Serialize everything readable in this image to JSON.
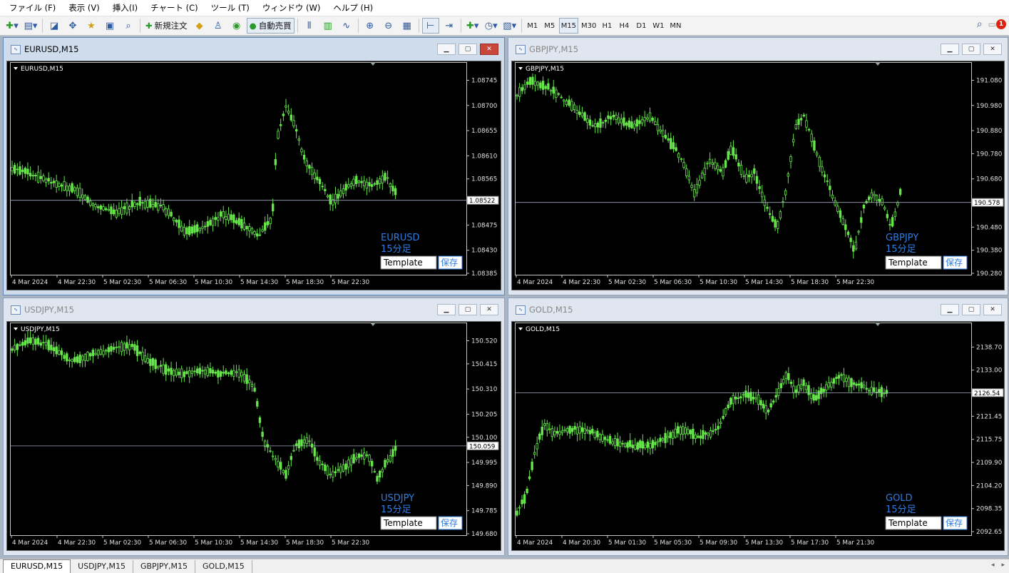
{
  "menu": [
    "ファイル (F)",
    "表示 (V)",
    "挿入(I)",
    "チャート (C)",
    "ツール (T)",
    "ウィンドウ (W)",
    "ヘルプ (H)"
  ],
  "toolbar": {
    "new_order": "新規注文",
    "auto_trade": "自動売買",
    "timeframes": [
      "M1",
      "M5",
      "M15",
      "M30",
      "H1",
      "H4",
      "D1",
      "W1",
      "MN"
    ],
    "active_timeframe": "M15",
    "notification_count": "1"
  },
  "panel": {
    "timeframe_label": "15分足",
    "template_value": "Template",
    "save_label": "保存"
  },
  "windows": [
    {
      "key": "eurusd",
      "title": "EURUSD,M15",
      "chart_label": "EURUSD,M15",
      "symbol": "EURUSD",
      "active": true,
      "price_ticks": [
        "1.08745",
        "1.08700",
        "1.08655",
        "1.08610",
        "1.08565",
        "1.08475",
        "1.08430",
        "1.08385"
      ],
      "current_price": "1.08522",
      "time_ticks": [
        "4 Mar 2024",
        "4 Mar 22:30",
        "5 Mar 02:30",
        "5 Mar 06:30",
        "5 Mar 10:30",
        "5 Mar 14:30",
        "5 Mar 18:30",
        "5 Mar 22:30"
      ]
    },
    {
      "key": "gbpjpy",
      "title": "GBPJPY,M15",
      "chart_label": "GBPJPY,M15",
      "symbol": "GBPJPY",
      "active": false,
      "price_ticks": [
        "191.080",
        "190.980",
        "190.880",
        "190.780",
        "190.680",
        "190.480",
        "190.380",
        "190.280"
      ],
      "current_price": "190.578",
      "time_ticks": [
        "4 Mar 2024",
        "4 Mar 22:30",
        "5 Mar 02:30",
        "5 Mar 06:30",
        "5 Mar 10:30",
        "5 Mar 14:30",
        "5 Mar 18:30",
        "5 Mar 22:30"
      ]
    },
    {
      "key": "usdjpy",
      "title": "USDJPY,M15",
      "chart_label": "USDJPY,M15",
      "symbol": "USDJPY",
      "active": false,
      "price_ticks": [
        "150.520",
        "150.415",
        "150.310",
        "150.205",
        "150.100",
        "149.995",
        "149.890",
        "149.785",
        "149.680"
      ],
      "current_price": "150.059",
      "time_ticks": [
        "4 Mar 2024",
        "4 Mar 22:30",
        "5 Mar 02:30",
        "5 Mar 06:30",
        "5 Mar 10:30",
        "5 Mar 14:30",
        "5 Mar 18:30",
        "5 Mar 22:30"
      ]
    },
    {
      "key": "gold",
      "title": "GOLD,M15",
      "chart_label": "GOLD,M15",
      "symbol": "GOLD",
      "active": false,
      "price_ticks": [
        "2138.70",
        "2133.00",
        "2121.45",
        "2115.75",
        "2109.90",
        "2104.20",
        "2098.35",
        "2092.65"
      ],
      "current_price": "2126.54",
      "time_ticks": [
        "4 Mar 2024",
        "4 Mar 20:30",
        "5 Mar 01:30",
        "5 Mar 05:30",
        "5 Mar 09:30",
        "5 Mar 13:30",
        "5 Mar 17:30",
        "5 Mar 21:30"
      ]
    }
  ],
  "tabs": [
    "EURUSD,M15",
    "USDJPY,M15",
    "GBPJPY,M15",
    "GOLD,M15"
  ],
  "colors": {
    "candle": "#66e64a",
    "price_line": "#a0a8b8",
    "label_text": "#2f7de0",
    "chart_bg": "#000000"
  },
  "icons": [
    "new-chart-icon",
    "profiles-icon",
    "market-watch-icon",
    "crosshair-icon",
    "navigator-icon",
    "terminal-icon",
    "strategy-tester-icon",
    "new-order-icon",
    "metaeditor-icon",
    "auto-trading-icon",
    "bar-chart-icon",
    "candlestick-icon",
    "line-chart-icon",
    "zoom-in-icon",
    "zoom-out-icon",
    "tile-windows-icon",
    "chart-shift-icon",
    "autoscroll-icon",
    "indicators-icon",
    "periods-icon",
    "templates-icon",
    "search-icon",
    "notification-icon"
  ]
}
